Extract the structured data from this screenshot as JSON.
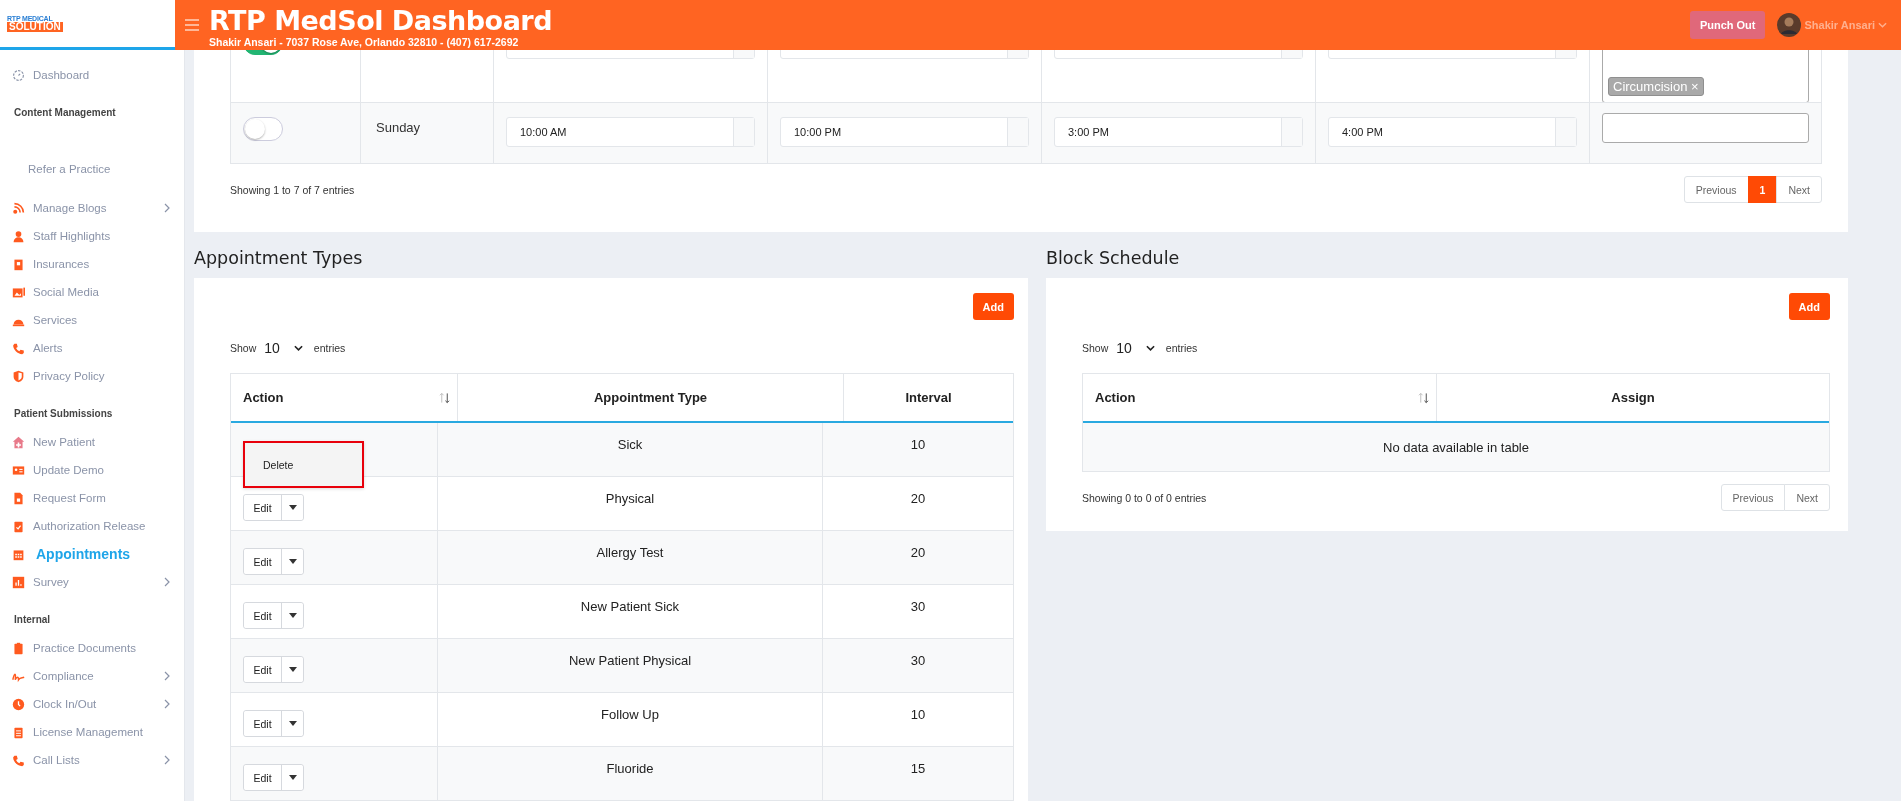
{
  "header": {
    "logo_top": "RTP MEDICAL",
    "logo_bottom": "SOLUTION",
    "title": "RTP MedSol Dashboard",
    "subtitle": "Shakir Ansari - 7037 Rose Ave, Orlando 32810 - (407) 617-2692",
    "punch_button": "Punch Out",
    "user_name": "Shakir Ansari"
  },
  "sidebar": {
    "sections": [
      {
        "items": [
          {
            "label": "Dashboard",
            "kind": "icon",
            "selected": false,
            "chevron": false
          }
        ]
      },
      {
        "heading": "Content Management",
        "items": [
          {
            "label": "Refer a Practice",
            "kind": "text",
            "selected": false,
            "chevron": false
          },
          {
            "label": "Manage Blogs",
            "kind": "icon",
            "selected": false,
            "chevron": true
          },
          {
            "label": "Staff Highlights",
            "kind": "icon",
            "selected": false,
            "chevron": false
          },
          {
            "label": "Insurances",
            "kind": "icon",
            "selected": false,
            "chevron": false
          },
          {
            "label": "Social Media",
            "kind": "icon",
            "selected": false,
            "chevron": false
          },
          {
            "label": "Services",
            "kind": "icon",
            "selected": false,
            "chevron": false
          },
          {
            "label": "Alerts",
            "kind": "icon",
            "selected": false,
            "chevron": false
          },
          {
            "label": "Privacy Policy",
            "kind": "icon",
            "selected": false,
            "chevron": false
          }
        ]
      },
      {
        "heading": "Patient Submissions",
        "items": [
          {
            "label": "New Patient",
            "kind": "icon",
            "selected": false,
            "chevron": false
          },
          {
            "label": "Update Demo",
            "kind": "icon",
            "selected": false,
            "chevron": false
          },
          {
            "label": "Request Form",
            "kind": "icon",
            "selected": false,
            "chevron": false
          },
          {
            "label": "Authorization Release",
            "kind": "icon",
            "selected": false,
            "chevron": false
          },
          {
            "label": "Appointments",
            "kind": "icon",
            "selected": true,
            "chevron": false
          },
          {
            "label": "Survey",
            "kind": "icon",
            "selected": false,
            "chevron": true
          }
        ]
      },
      {
        "heading": "Internal",
        "items": [
          {
            "label": "Practice Documents",
            "kind": "icon",
            "selected": false,
            "chevron": false
          },
          {
            "label": "Compliance",
            "kind": "icon",
            "selected": false,
            "chevron": true
          },
          {
            "label": "Clock In/Out",
            "kind": "icon",
            "selected": false,
            "chevron": true
          },
          {
            "label": "License Management",
            "kind": "icon",
            "selected": false,
            "chevron": false
          },
          {
            "label": "Call Lists",
            "kind": "icon",
            "selected": false,
            "chevron": true
          }
        ]
      }
    ]
  },
  "schedule": {
    "rows": [
      {
        "enabled": true,
        "partial": true,
        "tags": [
          "Circumcision ×"
        ]
      },
      {
        "enabled": false,
        "partial": false,
        "day": "Sunday",
        "times": [
          "10:00 AM",
          "10:00 PM",
          "3:00 PM",
          "4:00 PM"
        ],
        "tags": []
      }
    ],
    "info": "Showing 1 to 7 of 7 entries",
    "pagination": [
      {
        "label": "Previous",
        "selected": false
      },
      {
        "label": "1",
        "selected": true
      },
      {
        "label": "Next",
        "selected": false
      }
    ]
  },
  "appointment_types": {
    "title": "Appointment Types",
    "add_button": "Add",
    "show_label": "Show",
    "page_size": "10",
    "entries_label": "entries",
    "columns": [
      "Action",
      "Appointment Type",
      "Interval"
    ],
    "rows": [
      {
        "type": "Sick",
        "interval": "10",
        "menu_open": true,
        "menu_items": [
          "Delete"
        ],
        "highlighted": true
      },
      {
        "type": "Physical",
        "interval": "20",
        "menu_open": false,
        "edit_label": "Edit"
      },
      {
        "type": "Allergy Test",
        "interval": "20",
        "menu_open": false,
        "edit_label": "Edit"
      },
      {
        "type": "New Patient Sick",
        "interval": "30",
        "menu_open": false,
        "edit_label": "Edit"
      },
      {
        "type": "New Patient Physical",
        "interval": "30",
        "menu_open": false,
        "edit_label": "Edit"
      },
      {
        "type": "Follow Up",
        "interval": "10",
        "menu_open": false,
        "edit_label": "Edit"
      },
      {
        "type": "Fluoride",
        "interval": "15",
        "menu_open": false,
        "edit_label": "Edit"
      }
    ]
  },
  "block_schedule": {
    "title": "Block Schedule",
    "add_button": "Add",
    "show_label": "Show",
    "page_size": "10",
    "entries_label": "entries",
    "columns": [
      "Action",
      "Assign"
    ],
    "empty_message": "No data available in table",
    "info": "Showing 0 to 0 of 0 entries",
    "pagination": [
      {
        "label": "Previous",
        "selected": false
      },
      {
        "label": "Next",
        "selected": false
      }
    ]
  }
}
